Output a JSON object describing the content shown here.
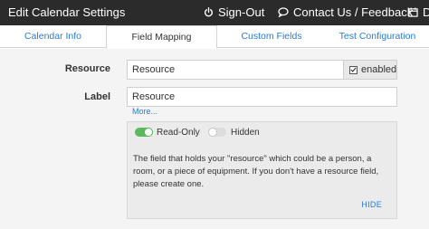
{
  "header": {
    "title": "Edit Calendar Settings",
    "nav": [
      {
        "label": "Sign-Out",
        "icon": "power-icon"
      },
      {
        "label": "Contact Us / Feedback",
        "icon": "chat-bubble-icon"
      },
      {
        "label": "De",
        "icon": "calendar-icon"
      }
    ]
  },
  "tabs": [
    {
      "label": "Calendar Info"
    },
    {
      "label": "Field Mapping"
    },
    {
      "label": "Custom Fields"
    },
    {
      "label": "Test Configuration"
    }
  ],
  "form": {
    "resource": {
      "label": "Resource",
      "value": "Resource",
      "addon_label": "enabled"
    },
    "label_field": {
      "label": "Label",
      "value": "Resource"
    },
    "more_link": "More...",
    "panel": {
      "read_only_label": "Read-Only",
      "hidden_label": "Hidden",
      "description": "The field that holds your \"resource\" which could be a person, a room, or a piece of equipment. If you don't have a resource field, please create one.",
      "hide_link": "HIDE"
    }
  },
  "colors": {
    "header_bg": "#2b2b2b",
    "link": "#2a7bd1",
    "toggle_on": "#5cb85c",
    "toggle_off": "#dddddd"
  }
}
